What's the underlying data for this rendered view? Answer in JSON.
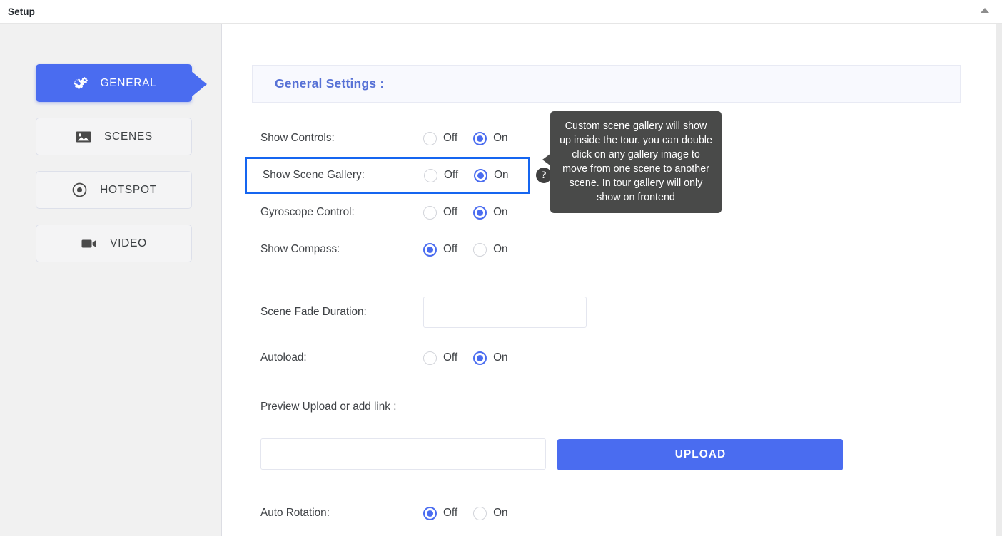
{
  "topbar": {
    "title": "Setup",
    "collapse_icon": "caret-up-icon"
  },
  "sidebar": {
    "items": [
      {
        "label": "GENERAL",
        "icon": "cogs-icon",
        "active": true
      },
      {
        "label": "SCENES",
        "icon": "image-icon",
        "active": false
      },
      {
        "label": "HOTSPOT",
        "icon": "dot-circle-icon",
        "active": false
      },
      {
        "label": "VIDEO",
        "icon": "video-icon",
        "active": false
      }
    ]
  },
  "panel": {
    "heading": "General Settings :"
  },
  "settings": {
    "show_controls": {
      "label": "Show Controls:",
      "off_label": "Off",
      "on_label": "On",
      "value": "On"
    },
    "show_scene_gallery": {
      "label": "Show Scene Gallery:",
      "off_label": "Off",
      "on_label": "On",
      "value": "On",
      "help_glyph": "?",
      "tooltip": "Custom scene gallery will show up inside the tour. you can double click on any gallery image to move from one scene to another scene. In tour gallery will only show on frontend"
    },
    "gyroscope_control": {
      "label": "Gyroscope Control:",
      "off_label": "Off",
      "on_label": "On",
      "value": "On"
    },
    "show_compass": {
      "label": "Show Compass:",
      "off_label": "Off",
      "on_label": "On",
      "value": "Off"
    },
    "scene_fade_duration": {
      "label": "Scene Fade Duration:",
      "value": "",
      "placeholder": ""
    },
    "autoload": {
      "label": "Autoload:",
      "off_label": "Off",
      "on_label": "On",
      "value": "On"
    },
    "preview_upload": {
      "label": "Preview Upload or add link :",
      "value": "",
      "placeholder": "",
      "button_label": "UPLOAD"
    },
    "auto_rotation": {
      "label": "Auto Rotation:",
      "off_label": "Off",
      "on_label": "On",
      "value": "Off"
    }
  },
  "colors": {
    "accent": "#4a6cf0",
    "heading": "#5872d6",
    "highlight_border": "#1565f0",
    "tooltip_bg": "#494a49",
    "sidebar_bg": "#f1f1f1"
  }
}
